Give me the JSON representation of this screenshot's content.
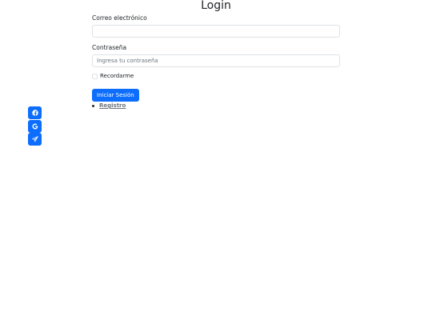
{
  "page": {
    "title": "Login"
  },
  "form": {
    "email_label": "Correo electrónico",
    "email_value": "",
    "email_placeholder": "",
    "password_label": "Contraseña",
    "password_value": "",
    "password_placeholder": "Ingresa tu contraseña",
    "remember_label": "Recordarme",
    "remember_checked": false,
    "submit_label": "Iniciar Sesión"
  },
  "links": [
    {
      "label": "Registro"
    }
  ],
  "social": [
    {
      "icon": "facebook-icon"
    },
    {
      "icon": "google-icon"
    },
    {
      "icon": "telegram-icon"
    }
  ],
  "colors": {
    "primary": "#0d6efd",
    "text": "#212529",
    "muted": "#6c757d",
    "border": "#dee2e6"
  }
}
